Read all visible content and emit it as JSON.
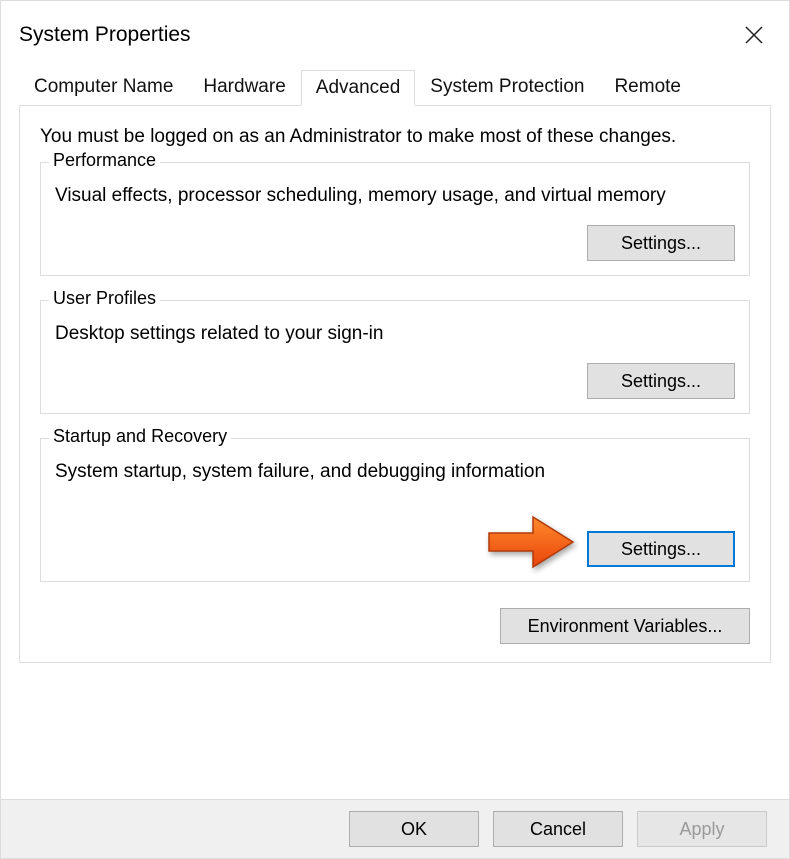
{
  "title": "System Properties",
  "tabs": [
    "Computer Name",
    "Hardware",
    "Advanced",
    "System Protection",
    "Remote"
  ],
  "activeTab": 2,
  "intro": "You must be logged on as an Administrator to make most of these changes.",
  "groups": {
    "performance": {
      "legend": "Performance",
      "desc": "Visual effects, processor scheduling, memory usage, and virtual memory",
      "button": "Settings..."
    },
    "userprofiles": {
      "legend": "User Profiles",
      "desc": "Desktop settings related to your sign-in",
      "button": "Settings..."
    },
    "startup": {
      "legend": "Startup and Recovery",
      "desc": "System startup, system failure, and debugging information",
      "button": "Settings..."
    }
  },
  "envbutton": "Environment Variables...",
  "footer": {
    "ok": "OK",
    "cancel": "Cancel",
    "apply": "Apply"
  }
}
